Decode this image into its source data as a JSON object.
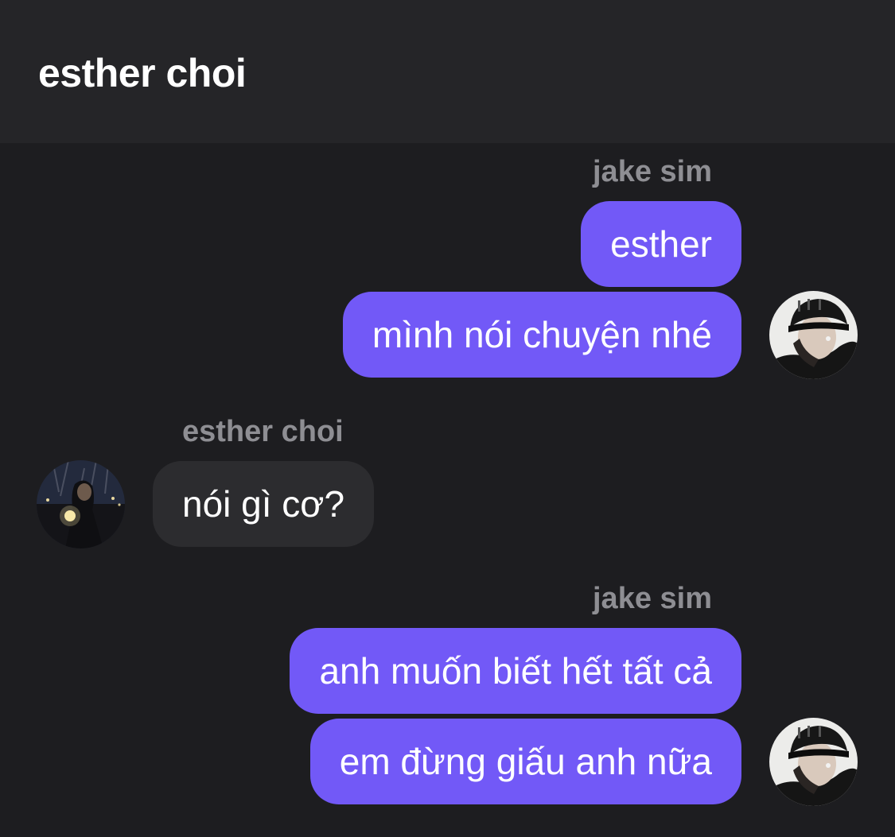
{
  "header": {
    "title": "esther choi"
  },
  "messages": [
    {
      "sender": "jake sim",
      "direction": "outgoing",
      "bubbles": [
        "esther",
        "mình nói chuyện nhé"
      ]
    },
    {
      "sender": "esther choi",
      "direction": "incoming",
      "bubbles": [
        "nói gì cơ?"
      ]
    },
    {
      "sender": "jake sim",
      "direction": "outgoing",
      "bubbles": [
        "anh muốn biết hết tất cả",
        "em đừng giấu anh nữa"
      ]
    }
  ],
  "colors": {
    "background": "#1d1d20",
    "header_background": "#252528",
    "outgoing_bubble": "#7259f7",
    "incoming_bubble": "#2c2c2f",
    "sender_label": "#8e8e93",
    "text": "#ffffff"
  },
  "avatars": {
    "jake_sim": "avatar-jake-sim",
    "esther_choi": "avatar-esther-choi"
  }
}
